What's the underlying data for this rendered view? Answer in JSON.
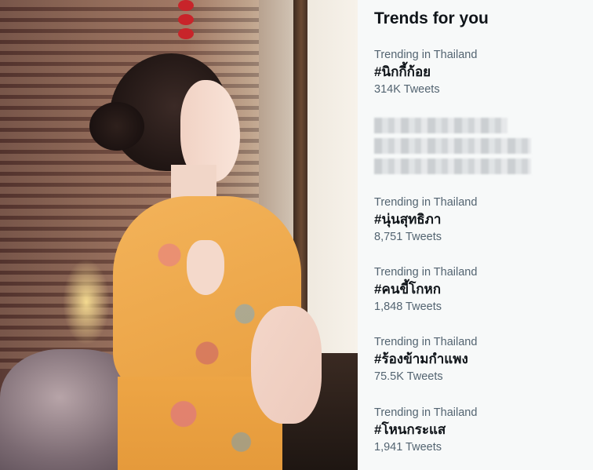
{
  "trends_panel": {
    "title": "Trends for you",
    "items": [
      {
        "context": "Trending in Thailand",
        "hashtag": "#นิกกี้ก้อย",
        "count": "314K Tweets"
      },
      {
        "context": "Trending in Thailand",
        "hashtag": "#นุ่นสุทธิภา",
        "count": "8,751 Tweets"
      },
      {
        "context": "Trending in Thailand",
        "hashtag": "#คนขี้โกหก",
        "count": "1,848 Tweets"
      },
      {
        "context": "Trending in Thailand",
        "hashtag": "#ร้องข้ามกำแพง",
        "count": "75.5K Tweets"
      },
      {
        "context": "Trending in Thailand",
        "hashtag": "#โหนกระแส",
        "count": "1,941 Tweets"
      }
    ]
  },
  "colors": {
    "panel_bg": "#f7f9f9",
    "primary_text": "#0f1419",
    "secondary_text": "#536471",
    "dress_orange": "#eda545"
  }
}
